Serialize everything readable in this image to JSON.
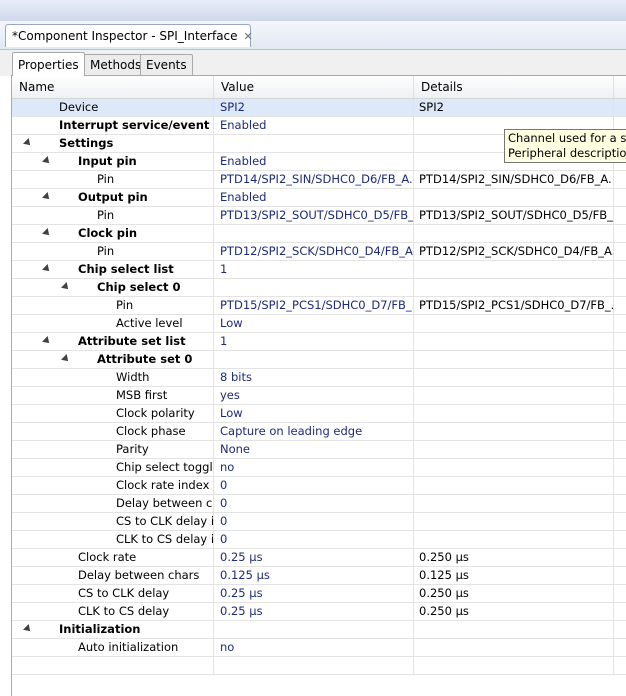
{
  "view": {
    "title": "*Component Inspector - SPI_Interface",
    "close_glyph": "✕",
    "background_ghost_text": "",
    "subtabs": [
      "Properties",
      "Methods",
      "Events"
    ]
  },
  "table": {
    "headers": [
      "Name",
      "Value",
      "Details"
    ],
    "rows": [
      {
        "name": "Device",
        "indent": 0,
        "bold": false,
        "expander": false,
        "value": "SPI2",
        "details": "SPI2",
        "selected": true
      },
      {
        "name": "Interrupt service/event",
        "indent": 0,
        "bold": true,
        "expander": false,
        "value": "Enabled",
        "details": ""
      },
      {
        "name": "Settings",
        "indent": 0,
        "bold": true,
        "expander": true,
        "value": "",
        "details": ""
      },
      {
        "name": "Input pin",
        "indent": 1,
        "bold": true,
        "expander": true,
        "value": "Enabled",
        "details": ""
      },
      {
        "name": "Pin",
        "indent": 2,
        "bold": false,
        "expander": false,
        "value": "PTD14/SPI2_SIN/SDHC0_D6/FB_A...",
        "details": "PTD14/SPI2_SIN/SDHC0_D6/FB_A..."
      },
      {
        "name": "Output pin",
        "indent": 1,
        "bold": true,
        "expander": true,
        "value": "Enabled",
        "details": ""
      },
      {
        "name": "Pin",
        "indent": 2,
        "bold": false,
        "expander": false,
        "value": "PTD13/SPI2_SOUT/SDHC0_D5/FB_...",
        "details": "PTD13/SPI2_SOUT/SDHC0_D5/FB_..."
      },
      {
        "name": "Clock pin",
        "indent": 1,
        "bold": true,
        "expander": true,
        "value": "",
        "details": ""
      },
      {
        "name": "Pin",
        "indent": 2,
        "bold": false,
        "expander": false,
        "value": "PTD12/SPI2_SCK/SDHC0_D4/FB_A...",
        "details": "PTD12/SPI2_SCK/SDHC0_D4/FB_A..."
      },
      {
        "name": "Chip select list",
        "indent": 1,
        "bold": true,
        "expander": true,
        "value": "1",
        "details": ""
      },
      {
        "name": "Chip select 0",
        "indent": 2,
        "bold": true,
        "expander": true,
        "value": "",
        "details": ""
      },
      {
        "name": "Pin",
        "indent": 3,
        "bold": false,
        "expander": false,
        "value": "PTD15/SPI2_PCS1/SDHC0_D7/FB_...",
        "details": "PTD15/SPI2_PCS1/SDHC0_D7/FB_..."
      },
      {
        "name": "Active level",
        "indent": 3,
        "bold": false,
        "expander": false,
        "value": "Low",
        "details": ""
      },
      {
        "name": "Attribute set list",
        "indent": 1,
        "bold": true,
        "expander": true,
        "value": "1",
        "details": ""
      },
      {
        "name": "Attribute set 0",
        "indent": 2,
        "bold": true,
        "expander": true,
        "value": "",
        "details": ""
      },
      {
        "name": "Width",
        "indent": 3,
        "bold": false,
        "expander": false,
        "value": "8 bits",
        "details": ""
      },
      {
        "name": "MSB first",
        "indent": 3,
        "bold": false,
        "expander": false,
        "value": "yes",
        "details": ""
      },
      {
        "name": "Clock polarity",
        "indent": 3,
        "bold": false,
        "expander": false,
        "value": "Low",
        "details": ""
      },
      {
        "name": "Clock phase",
        "indent": 3,
        "bold": false,
        "expander": false,
        "value": "Capture on leading edge",
        "details": ""
      },
      {
        "name": "Parity",
        "indent": 3,
        "bold": false,
        "expander": false,
        "value": "None",
        "details": ""
      },
      {
        "name": "Chip select togglin",
        "indent": 3,
        "bold": false,
        "expander": false,
        "value": "no",
        "details": ""
      },
      {
        "name": "Clock rate index",
        "indent": 3,
        "bold": false,
        "expander": false,
        "value": "0",
        "details": ""
      },
      {
        "name": "Delay between cha",
        "indent": 3,
        "bold": false,
        "expander": false,
        "value": "0",
        "details": ""
      },
      {
        "name": "CS to CLK delay in",
        "indent": 3,
        "bold": false,
        "expander": false,
        "value": "0",
        "details": ""
      },
      {
        "name": "CLK to CS delay in",
        "indent": 3,
        "bold": false,
        "expander": false,
        "value": "0",
        "details": ""
      },
      {
        "name": "Clock rate",
        "indent": 1,
        "bold": false,
        "expander": false,
        "value": "0.25 µs",
        "details": "0.250 µs"
      },
      {
        "name": "Delay between chars",
        "indent": 1,
        "bold": false,
        "expander": false,
        "value": "0.125 µs",
        "details": "0.125 µs"
      },
      {
        "name": "CS to CLK delay",
        "indent": 1,
        "bold": false,
        "expander": false,
        "value": "0.25 µs",
        "details": "0.250 µs"
      },
      {
        "name": "CLK to CS delay",
        "indent": 1,
        "bold": false,
        "expander": false,
        "value": "0.25 µs",
        "details": "0.250 µs"
      },
      {
        "name": "Initialization",
        "indent": 0,
        "bold": true,
        "expander": true,
        "value": "",
        "details": ""
      },
      {
        "name": "Auto initialization",
        "indent": 1,
        "bold": false,
        "expander": false,
        "value": "no",
        "details": ""
      },
      {
        "name": "",
        "indent": 0,
        "bold": false,
        "expander": false,
        "value": "",
        "details": ""
      }
    ]
  },
  "tooltip": {
    "line1": "Channel used for a seri",
    "line2": "Peripheral description:"
  },
  "colors": {
    "value_text": "#1c2a7a",
    "selected_row": "#dde8f8",
    "tooltip_bg": "#ffffe1"
  }
}
